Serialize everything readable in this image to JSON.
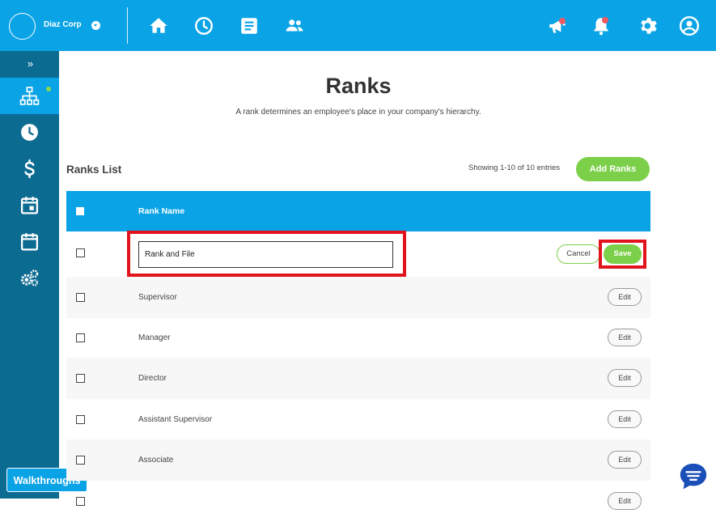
{
  "header": {
    "company": "Diaz Corp",
    "nav": [
      "home-icon",
      "clock-icon",
      "document-icon",
      "people-icon"
    ],
    "actions": [
      "megaphone-icon",
      "bell-icon",
      "gear-icon",
      "user-icon"
    ]
  },
  "sidebar": {
    "toggle": "»",
    "items": [
      "org-chart-icon",
      "clock-icon",
      "dollar-icon",
      "calendar-icon",
      "calendar-blank-icon",
      "settings-gears-icon"
    ],
    "walkthroughs": "Walkthroughs"
  },
  "page": {
    "title": "Ranks",
    "subtitle": "A rank determines an employee's place in your company's hierarchy."
  },
  "list": {
    "title": "Ranks List",
    "entries": "Showing 1-10 of 10 entries",
    "add_label": "Add Ranks",
    "column": "Rank Name",
    "edit_value": "Rank and File",
    "cancel_label": "Cancel",
    "save_label": "Save",
    "rows": [
      {
        "name": "Supervisor",
        "action": "Edit"
      },
      {
        "name": "Manager",
        "action": "Edit"
      },
      {
        "name": "Director",
        "action": "Edit"
      },
      {
        "name": "Assistant Supervisor",
        "action": "Edit"
      },
      {
        "name": "Associate",
        "action": "Edit"
      },
      {
        "name": "",
        "action": "Edit"
      }
    ]
  },
  "colors": {
    "primary": "#0aa3e6",
    "sidebar": "#0c6b91",
    "accent_green": "#7ccf49",
    "highlight_red": "#e1141e"
  }
}
